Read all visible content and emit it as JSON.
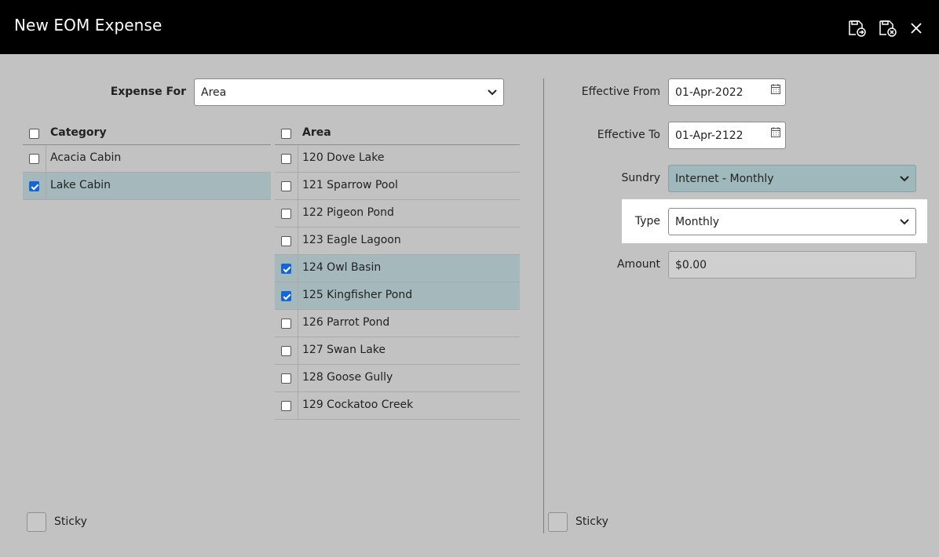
{
  "window": {
    "title": "New EOM Expense",
    "actions": [
      {
        "icon": "save-next-icon"
      },
      {
        "icon": "save-close-icon"
      },
      {
        "icon": "close-icon"
      }
    ]
  },
  "left": {
    "expense_for": {
      "label": "Expense For",
      "value": "Area"
    },
    "category_grid": {
      "header": "Category",
      "rows": [
        {
          "label": "Acacia Cabin",
          "checked": false
        },
        {
          "label": "Lake Cabin",
          "checked": true
        }
      ]
    },
    "area_grid": {
      "header": "Area",
      "rows": [
        {
          "label": "120 Dove Lake",
          "checked": false
        },
        {
          "label": "121 Sparrow Pool",
          "checked": false
        },
        {
          "label": "122 Pigeon Pond",
          "checked": false
        },
        {
          "label": "123 Eagle Lagoon",
          "checked": false
        },
        {
          "label": "124 Owl Basin",
          "checked": true
        },
        {
          "label": "125 Kingfisher Pond",
          "checked": true
        },
        {
          "label": "126 Parrot Pond",
          "checked": false
        },
        {
          "label": "127 Swan Lake",
          "checked": false
        },
        {
          "label": "128 Goose Gully",
          "checked": false
        },
        {
          "label": "129 Cockatoo Creek",
          "checked": false
        }
      ]
    },
    "sticky_label": "Sticky"
  },
  "right": {
    "effective_from": {
      "label": "Effective From",
      "value": "01-Apr-2022"
    },
    "effective_to": {
      "label": "Effective To",
      "value": "01-Apr-2122"
    },
    "sundry": {
      "label": "Sundry",
      "value": "Internet - Monthly"
    },
    "type": {
      "label": "Type",
      "value": "Monthly"
    },
    "amount": {
      "label": "Amount",
      "value": "$0.00"
    },
    "sticky_label": "Sticky"
  },
  "colors": {
    "titlebar": "#000000",
    "background": "#c2c2c2",
    "selected_row": "#a5b9bd",
    "checkbox_checked": "#1565d8",
    "highlight": "#ffffff"
  }
}
